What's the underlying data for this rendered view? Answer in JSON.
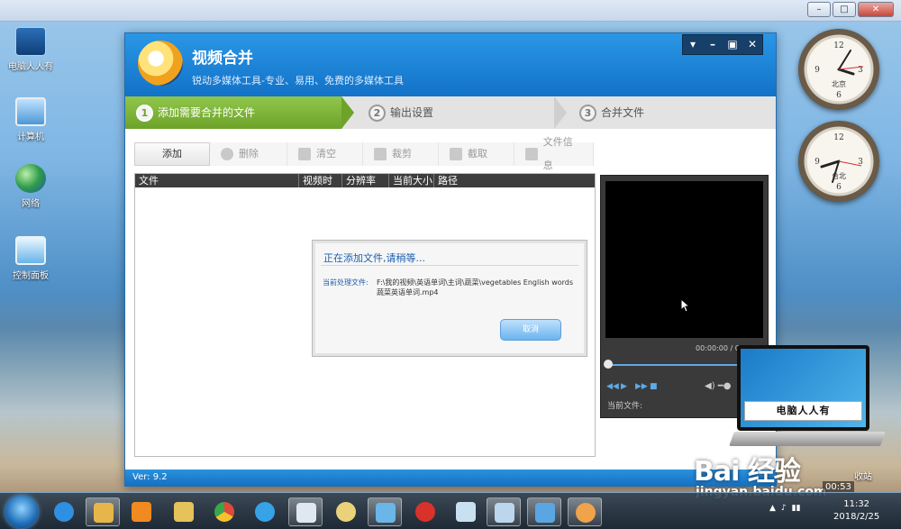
{
  "desktop": {
    "icons": [
      {
        "label": "电脑人人有",
        "icon": "computer-logo-icon"
      },
      {
        "label": "计算机",
        "icon": "computer-icon"
      },
      {
        "label": "网络",
        "icon": "network-globe-icon"
      },
      {
        "label": "控制面板",
        "icon": "control-panel-icon"
      }
    ],
    "clocks": [
      {
        "city": "北京",
        "hour": 4,
        "minute": 10
      },
      {
        "city": "台北",
        "hour": 8,
        "minute": 32
      }
    ],
    "recycle_label": "收站"
  },
  "app": {
    "title": "视频合并",
    "subtitle": "锐动多媒体工具-专业、易用、免费的多媒体工具",
    "controls": [
      "▾",
      "–",
      "▣",
      "✕"
    ],
    "steps": [
      {
        "num": "1",
        "label": "添加需要合并的文件",
        "active": true
      },
      {
        "num": "2",
        "label": "输出设置",
        "active": false
      },
      {
        "num": "3",
        "label": "合并文件",
        "active": false
      }
    ],
    "toolbar": {
      "add": "添加",
      "delete": "删除",
      "clear": "清空",
      "cut": "裁剪",
      "crop": "截取",
      "info": "文件信息"
    },
    "table": {
      "columns": [
        "文件",
        "视频时长",
        "分辨率",
        "当前大小",
        "路径"
      ]
    },
    "dialog": {
      "title": "正在添加文件,请稍等...",
      "label": "当前处理文件:",
      "path": "F:\\我的视频\\英语单词\\主词\\蔬菜\\vegetables English words 蔬菜英语单词.mp4",
      "cancel": "取消"
    },
    "player": {
      "time": "00:00:00 / 0",
      "current_file_label": "当前文件:",
      "progress": 0.0
    },
    "version": "Ver: 9.2"
  },
  "overlay": {
    "laptop_label": "电脑人人有",
    "watermark": "Bai 经验",
    "watermark_url": "jingyan.baidu.com",
    "rec_time": "00:53"
  },
  "taskbar": {
    "time": "11:32",
    "date": "2018/2/25",
    "apps": [
      {
        "icon": "ie-icon",
        "color": "#2f8fe0"
      },
      {
        "icon": "explorer-folder-icon",
        "color": "#e7b64a"
      },
      {
        "icon": "media-player-icon",
        "color": "#f28a22"
      },
      {
        "icon": "folder-icon",
        "color": "#e6c25a"
      },
      {
        "icon": "chrome-icon",
        "color": "#e04a3a"
      },
      {
        "icon": "browser-icon",
        "color": "#35a3e6"
      },
      {
        "icon": "document-icon",
        "color": "#dfe7f1"
      },
      {
        "icon": "paint-icon",
        "color": "#e9d27a"
      },
      {
        "icon": "monitor-icon",
        "color": "#6bb5e8"
      },
      {
        "icon": "chess-icon",
        "color": "#d8322a"
      },
      {
        "icon": "recycle-icon",
        "color": "#c9e0f0"
      },
      {
        "icon": "window-icon",
        "color": "#bcd6ee"
      },
      {
        "icon": "app-window-icon",
        "color": "#5aa6e3"
      },
      {
        "icon": "video-tool-icon",
        "color": "#f0a34a"
      }
    ]
  }
}
